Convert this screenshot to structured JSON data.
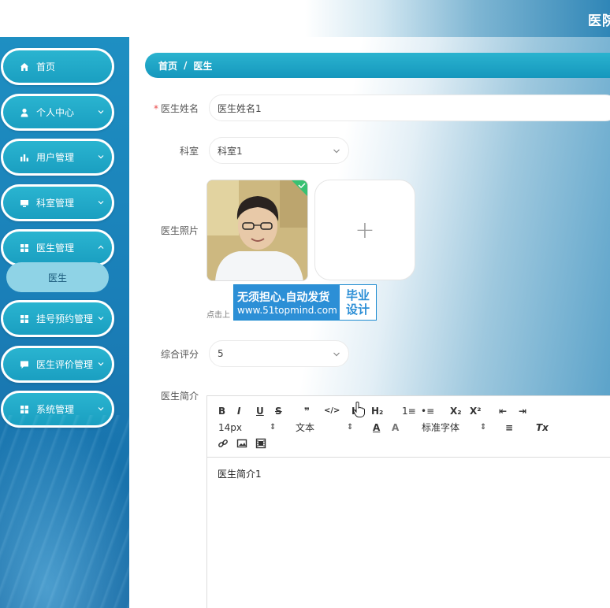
{
  "header": {
    "title": "医院"
  },
  "sidebar": {
    "items": [
      {
        "label": "首页",
        "icon": "home-icon",
        "has_arrow": false
      },
      {
        "label": "个人中心",
        "icon": "user-icon",
        "has_arrow": true
      },
      {
        "label": "用户管理",
        "icon": "chart-bar-icon",
        "has_arrow": true
      },
      {
        "label": "科室管理",
        "icon": "monitor-icon",
        "has_arrow": true
      },
      {
        "label": "医生管理",
        "icon": "grid-icon",
        "has_arrow": true
      },
      {
        "label": "挂号预约管理",
        "icon": "grid-icon",
        "has_arrow": true
      },
      {
        "label": "医生评价管理",
        "icon": "comment-icon",
        "has_arrow": true
      },
      {
        "label": "系统管理",
        "icon": "grid-icon",
        "has_arrow": true
      }
    ],
    "submenu": {
      "label": "医生"
    }
  },
  "breadcrumb": {
    "home": "首页",
    "separator": "/",
    "current": "医生"
  },
  "form": {
    "name": {
      "label": "医生姓名",
      "required_mark": "*",
      "value": "医生姓名1"
    },
    "department": {
      "label": "科室",
      "value": "科室1"
    },
    "photo": {
      "label": "医生照片",
      "tip": "点击上",
      "upload_plus": "+"
    },
    "rating": {
      "label": "综合评分",
      "value": "5"
    },
    "intro": {
      "label": "医生简介"
    }
  },
  "watermark": {
    "line1": "无须担心.自动发货",
    "line2": "www.51topmind.com",
    "right1": "毕业",
    "right2": "设计"
  },
  "editor": {
    "toolbar": {
      "bold": "B",
      "italic": "I",
      "underline": "U",
      "strike": "S",
      "quote": "❞",
      "code": "</>",
      "h1": "H₁",
      "h2": "H₂",
      "ordered_list": "1≡",
      "bullet_list": "•≡",
      "subscript": "X₂",
      "superscript": "X²",
      "outdent": "⇤",
      "indent": "⇥",
      "size": "14px",
      "size_arrow": "⇕",
      "header": "文本",
      "header_arrow": "⇕",
      "font": "标准字体",
      "font_arrow": "⇕",
      "color": "A",
      "background": "A",
      "align": "≡",
      "clean": "Tx"
    },
    "content": "医生简介1"
  },
  "colors": {
    "accent": "#1fa7c8",
    "sidebar": "#1a7fb8",
    "submenu": "#8fd3e6",
    "required": "#e94b4b"
  }
}
